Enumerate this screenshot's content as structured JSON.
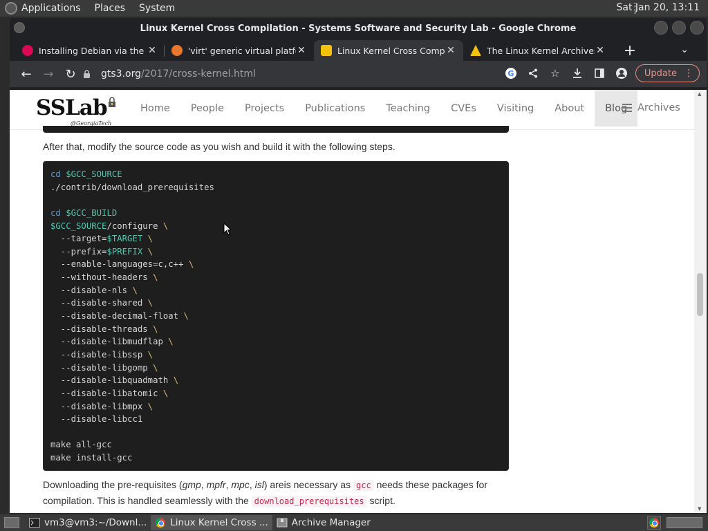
{
  "top_panel": {
    "menus": [
      "Applications",
      "Places",
      "System"
    ],
    "clock": "Sat Jan 20, 13:11"
  },
  "window": {
    "title": "Linux Kernel Cross Compilation - Systems Software and Security Lab - Google Chrome"
  },
  "tabs": [
    {
      "label": "Installing Debian via the In",
      "favicon_color": "#d70a53",
      "active": false
    },
    {
      "label": "'virt' generic virtual platfo",
      "favicon_color": "#e8762d",
      "active": false
    },
    {
      "label": "Linux Kernel Cross Compi",
      "favicon_color": "#f4c20d",
      "active": true
    },
    {
      "label": "The Linux Kernel Archives",
      "favicon_color": "#f4c20d",
      "active": false
    }
  ],
  "omnibox": {
    "host": "gts3.org",
    "path": "/2017/cross-kernel.html"
  },
  "toolbar": {
    "update_label": "Update"
  },
  "site": {
    "brand": "SSLab",
    "brand_sub": "@GeorgiaTech",
    "nav": [
      "Home",
      "People",
      "Projects",
      "Publications",
      "Teaching",
      "CVEs",
      "Visiting",
      "About",
      "Blog"
    ],
    "active_nav": "Blog",
    "archives": "Archives"
  },
  "article": {
    "para1": "After that, modify the source code as you wish and build it with the following steps.",
    "para2_parts": {
      "a": "Downloading the pre-requisites (",
      "gmp": "gmp",
      "sep1": ", ",
      "mpfr": "mpfr",
      "sep2": ", ",
      "mpc": "mpc",
      "sep3": ", ",
      "isl": "isl",
      "b": ") areis necessary as ",
      "code1": "gcc",
      "c": " needs these packages for compilation. This is handled seamlessly with the ",
      "code2": "download_prerequisites",
      "d": " script."
    }
  },
  "code_lines": [
    [
      {
        "t": "kw",
        "v": "cd "
      },
      {
        "t": "var",
        "v": "$GCC_SOURCE"
      }
    ],
    [
      {
        "t": "txt",
        "v": "./contrib/download_prerequisites"
      }
    ],
    [],
    [
      {
        "t": "kw",
        "v": "cd "
      },
      {
        "t": "var",
        "v": "$GCC_BUILD"
      }
    ],
    [
      {
        "t": "var",
        "v": "$GCC_SOURCE"
      },
      {
        "t": "txt",
        "v": "/configure "
      },
      {
        "t": "bs",
        "v": "\\"
      }
    ],
    [
      {
        "t": "txt",
        "v": "  --target="
      },
      {
        "t": "var",
        "v": "$TARGET"
      },
      {
        "t": "txt",
        "v": " "
      },
      {
        "t": "bs",
        "v": "\\"
      }
    ],
    [
      {
        "t": "txt",
        "v": "  --prefix="
      },
      {
        "t": "var",
        "v": "$PREFIX"
      },
      {
        "t": "txt",
        "v": " "
      },
      {
        "t": "bs",
        "v": "\\"
      }
    ],
    [
      {
        "t": "txt",
        "v": "  --enable-languages=c,c++ "
      },
      {
        "t": "bs",
        "v": "\\"
      }
    ],
    [
      {
        "t": "txt",
        "v": "  --without-headers "
      },
      {
        "t": "bs",
        "v": "\\"
      }
    ],
    [
      {
        "t": "txt",
        "v": "  --disable-nls "
      },
      {
        "t": "bs",
        "v": "\\"
      }
    ],
    [
      {
        "t": "txt",
        "v": "  --disable-shared "
      },
      {
        "t": "bs",
        "v": "\\"
      }
    ],
    [
      {
        "t": "txt",
        "v": "  --disable-decimal-float "
      },
      {
        "t": "bs",
        "v": "\\"
      }
    ],
    [
      {
        "t": "txt",
        "v": "  --disable-threads "
      },
      {
        "t": "bs",
        "v": "\\"
      }
    ],
    [
      {
        "t": "txt",
        "v": "  --disable-libmudflap "
      },
      {
        "t": "bs",
        "v": "\\"
      }
    ],
    [
      {
        "t": "txt",
        "v": "  --disable-libssp "
      },
      {
        "t": "bs",
        "v": "\\"
      }
    ],
    [
      {
        "t": "txt",
        "v": "  --disable-libgomp "
      },
      {
        "t": "bs",
        "v": "\\"
      }
    ],
    [
      {
        "t": "txt",
        "v": "  --disable-libquadmath "
      },
      {
        "t": "bs",
        "v": "\\"
      }
    ],
    [
      {
        "t": "txt",
        "v": "  --disable-libatomic "
      },
      {
        "t": "bs",
        "v": "\\"
      }
    ],
    [
      {
        "t": "txt",
        "v": "  --disable-libmpx "
      },
      {
        "t": "bs",
        "v": "\\"
      }
    ],
    [
      {
        "t": "txt",
        "v": "  --disable-libcc1"
      }
    ],
    [],
    [
      {
        "t": "txt",
        "v": "make all-gcc"
      }
    ],
    [
      {
        "t": "txt",
        "v": "make install-gcc"
      }
    ]
  ],
  "taskbar": {
    "tasks": [
      {
        "label": "vm3@vm3:~/Downl...",
        "icon": "terminal-icon",
        "active": false
      },
      {
        "label": "Linux Kernel Cross ...",
        "icon": "chrome-icon",
        "active": true
      },
      {
        "label": "Archive Manager",
        "icon": "archive-icon",
        "active": false
      }
    ]
  }
}
